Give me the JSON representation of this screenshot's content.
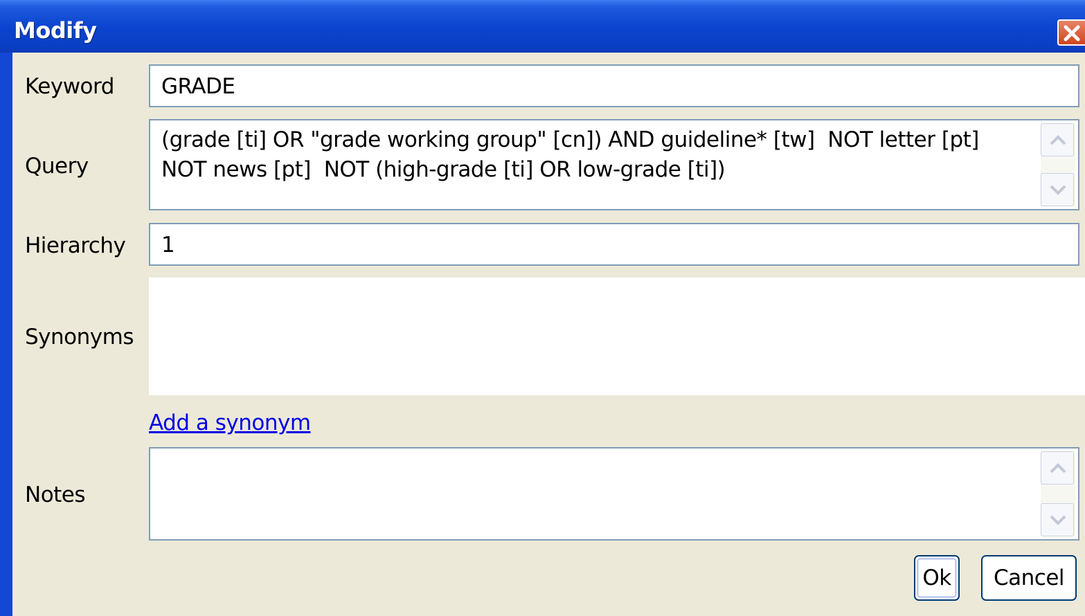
{
  "window": {
    "title": "Modify"
  },
  "form": {
    "keyword": {
      "label": "Keyword",
      "value": "GRADE"
    },
    "query": {
      "label": "Query",
      "lines": [
        "(grade [ti] OR \"grade working group\" [cn]) AND guideline* [tw]  NOT letter [pt]",
        "NOT news [pt]  NOT (high-grade [ti] OR low-grade [ti])"
      ]
    },
    "hierarchy": {
      "label": "Hierarchy",
      "value": "1"
    },
    "synonyms": {
      "label": "Synonyms",
      "add_link": "Add a synonym"
    },
    "notes": {
      "label": "Notes",
      "value": ""
    }
  },
  "buttons": {
    "ok": "Ok",
    "cancel": "Cancel"
  },
  "icons": {
    "close": "close-icon",
    "scroll_up": "chevron-up-icon",
    "scroll_down": "chevron-down-icon"
  },
  "colors": {
    "title_bar": "#0c44cf",
    "client_bg": "#ece9d8",
    "field_border": "#7f9db9",
    "link": "#0000e6",
    "close_button": "#d0441c"
  }
}
